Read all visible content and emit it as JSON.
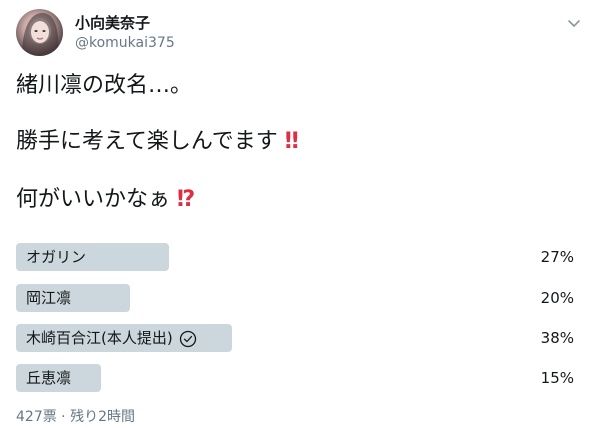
{
  "author": {
    "display_name": "小向美奈子",
    "handle": "@komukai375"
  },
  "tweet": {
    "line1": "緒川凛の改名…。",
    "line2": "勝手に考えて楽しんでます",
    "line2_emoji": "‼",
    "line3": "何がいいかなぁ",
    "line3_emoji": "⁉"
  },
  "poll": {
    "options": [
      {
        "label": "オガリン",
        "percent_text": "27%",
        "percent": 27,
        "selected": false
      },
      {
        "label": "岡江凛",
        "percent_text": "20%",
        "percent": 20,
        "selected": false
      },
      {
        "label": "木崎百合江(本人提出)",
        "percent_text": "38%",
        "percent": 38,
        "selected": true
      },
      {
        "label": "丘恵凛",
        "percent_text": "15%",
        "percent": 15,
        "selected": false
      }
    ],
    "meta": "427票 · 残り2時間"
  },
  "icons": {
    "caret": "chevron-down-icon",
    "selected": "check-circle-icon"
  },
  "colors": {
    "bar": "#ccd6dd",
    "emoji_red": "#dd2e44",
    "secondary_text": "#657786"
  }
}
